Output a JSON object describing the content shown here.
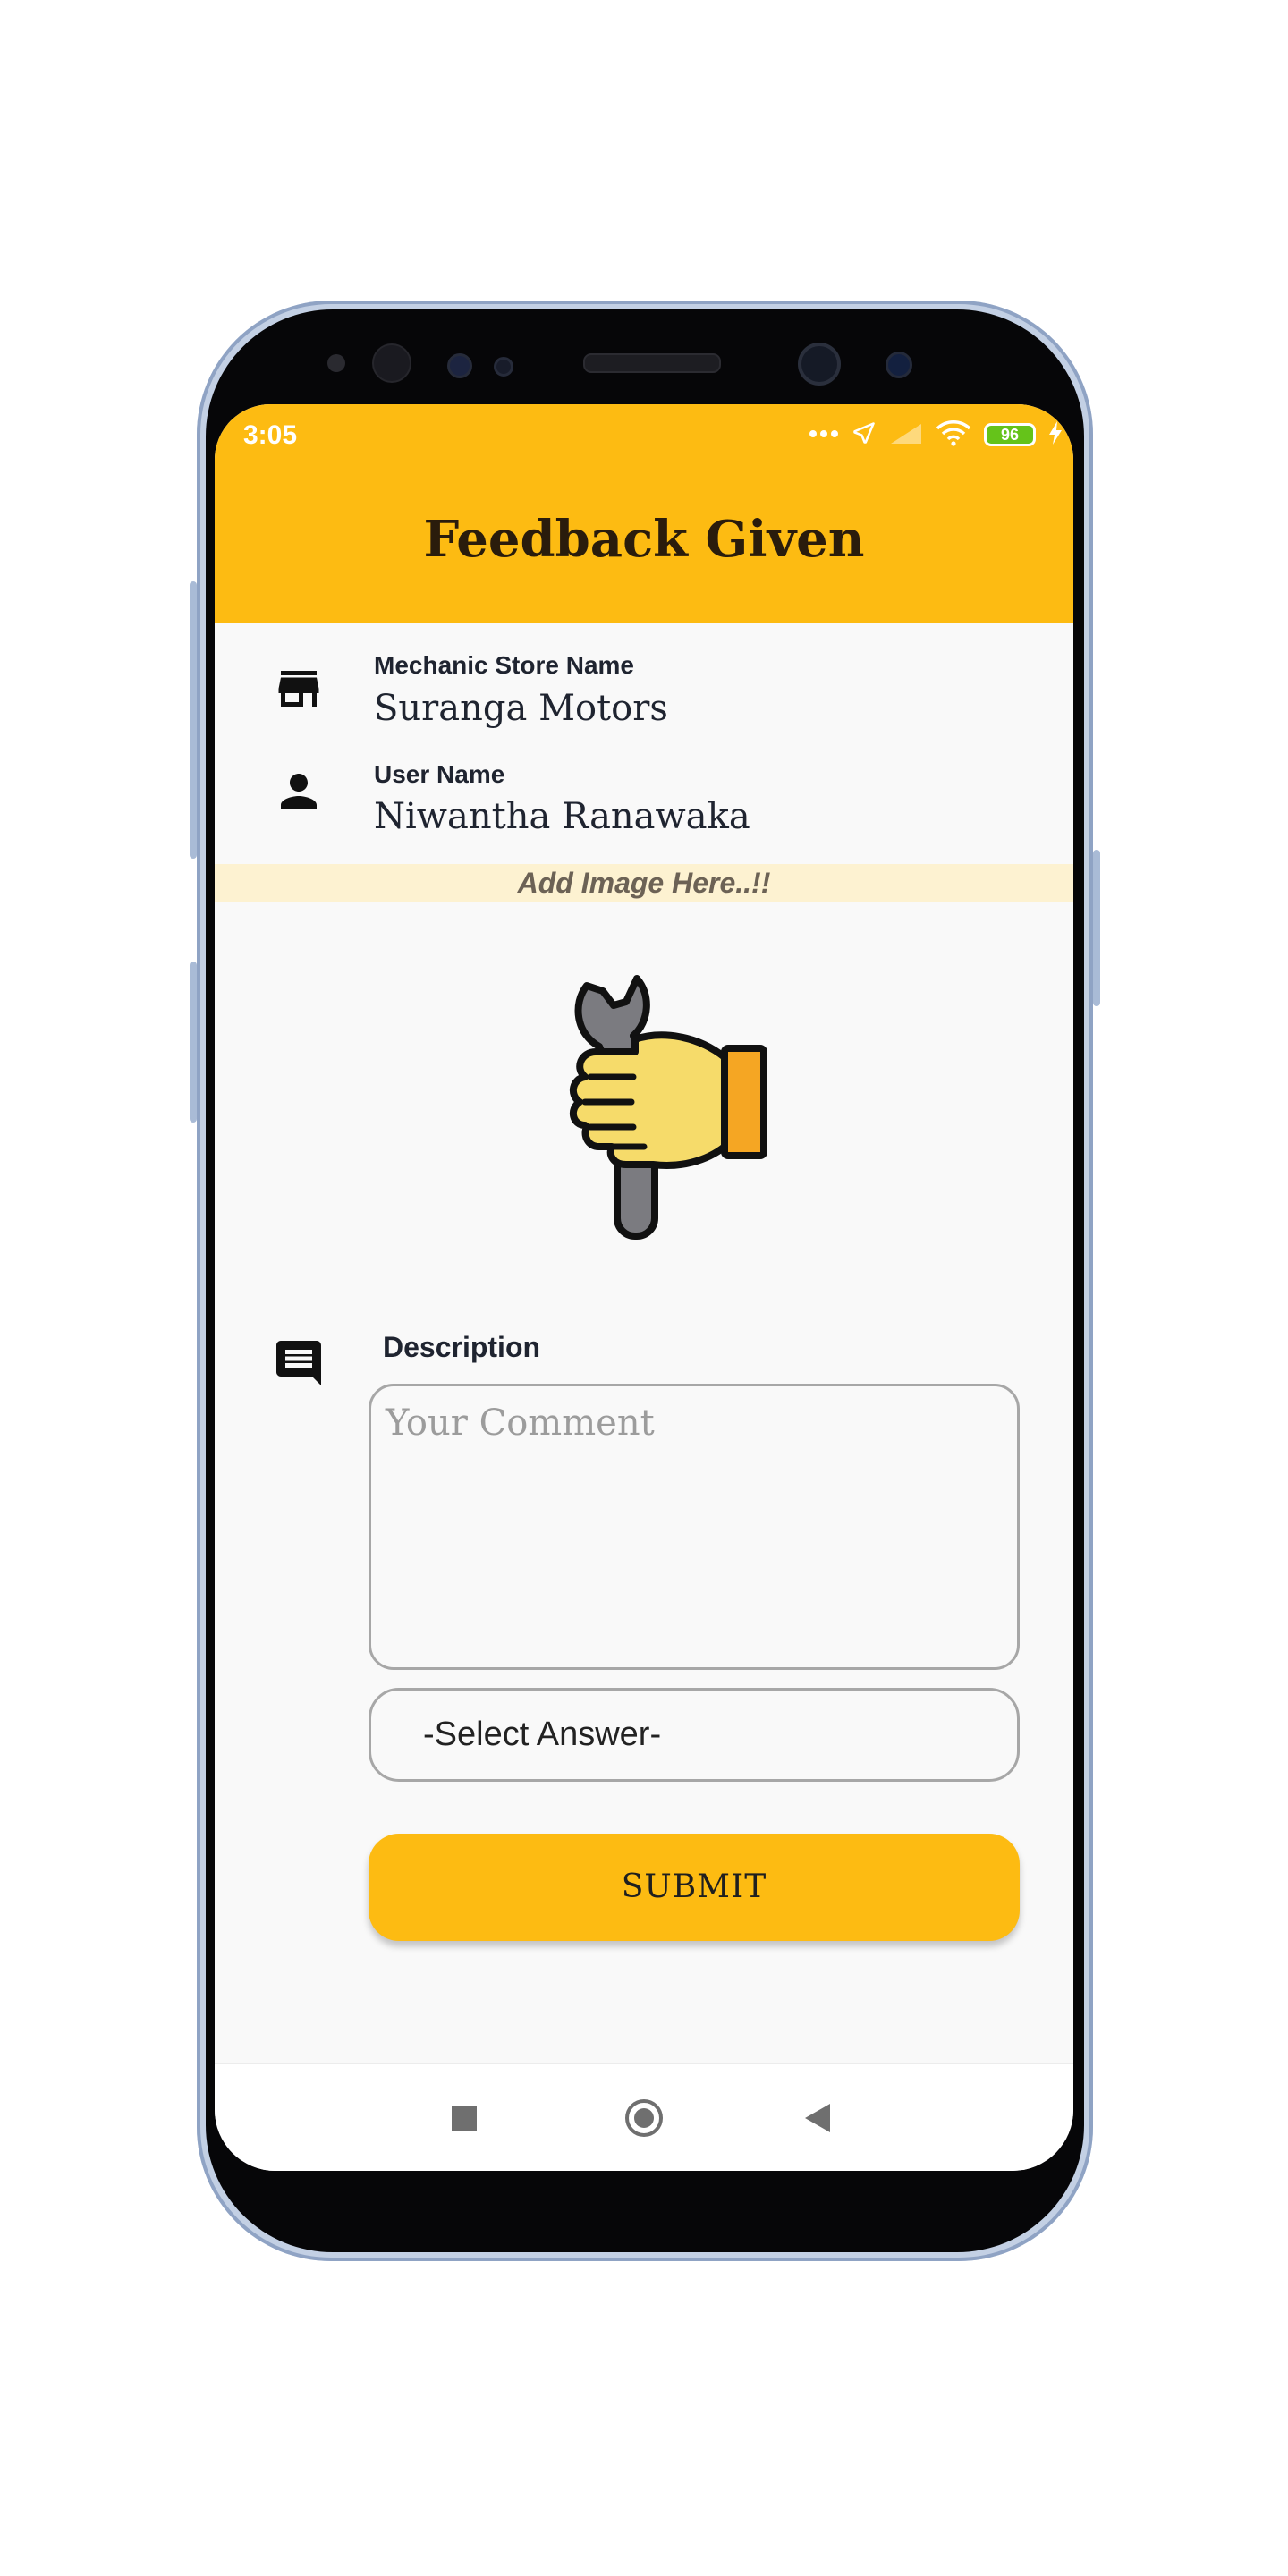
{
  "status_bar": {
    "time": "3:05",
    "battery": "96",
    "icons": [
      "more-dots-icon",
      "location-icon",
      "signal-icon",
      "wifi-icon",
      "battery-icon",
      "charging-icon"
    ]
  },
  "header": {
    "title": "Feedback Given",
    "background_color": "#fdbb12"
  },
  "store": {
    "label": "Mechanic Store Name",
    "value": "Suranga Motors",
    "icon": "store-icon"
  },
  "user": {
    "label": "User Name",
    "value": "Niwantha Ranawaka",
    "icon": "person-icon"
  },
  "image_section": {
    "text": "Add Image Here..!!",
    "illustration": "thumbs-down-wrench-icon"
  },
  "description": {
    "label": "Description",
    "icon": "comment-icon",
    "placeholder": "Your Comment",
    "value": ""
  },
  "select": {
    "value": "-Select Answer-"
  },
  "submit": {
    "label": "SUBMIT",
    "color": "#fdbb12"
  },
  "nav": {
    "icons": [
      "recent-apps-icon",
      "home-icon",
      "back-icon"
    ]
  }
}
